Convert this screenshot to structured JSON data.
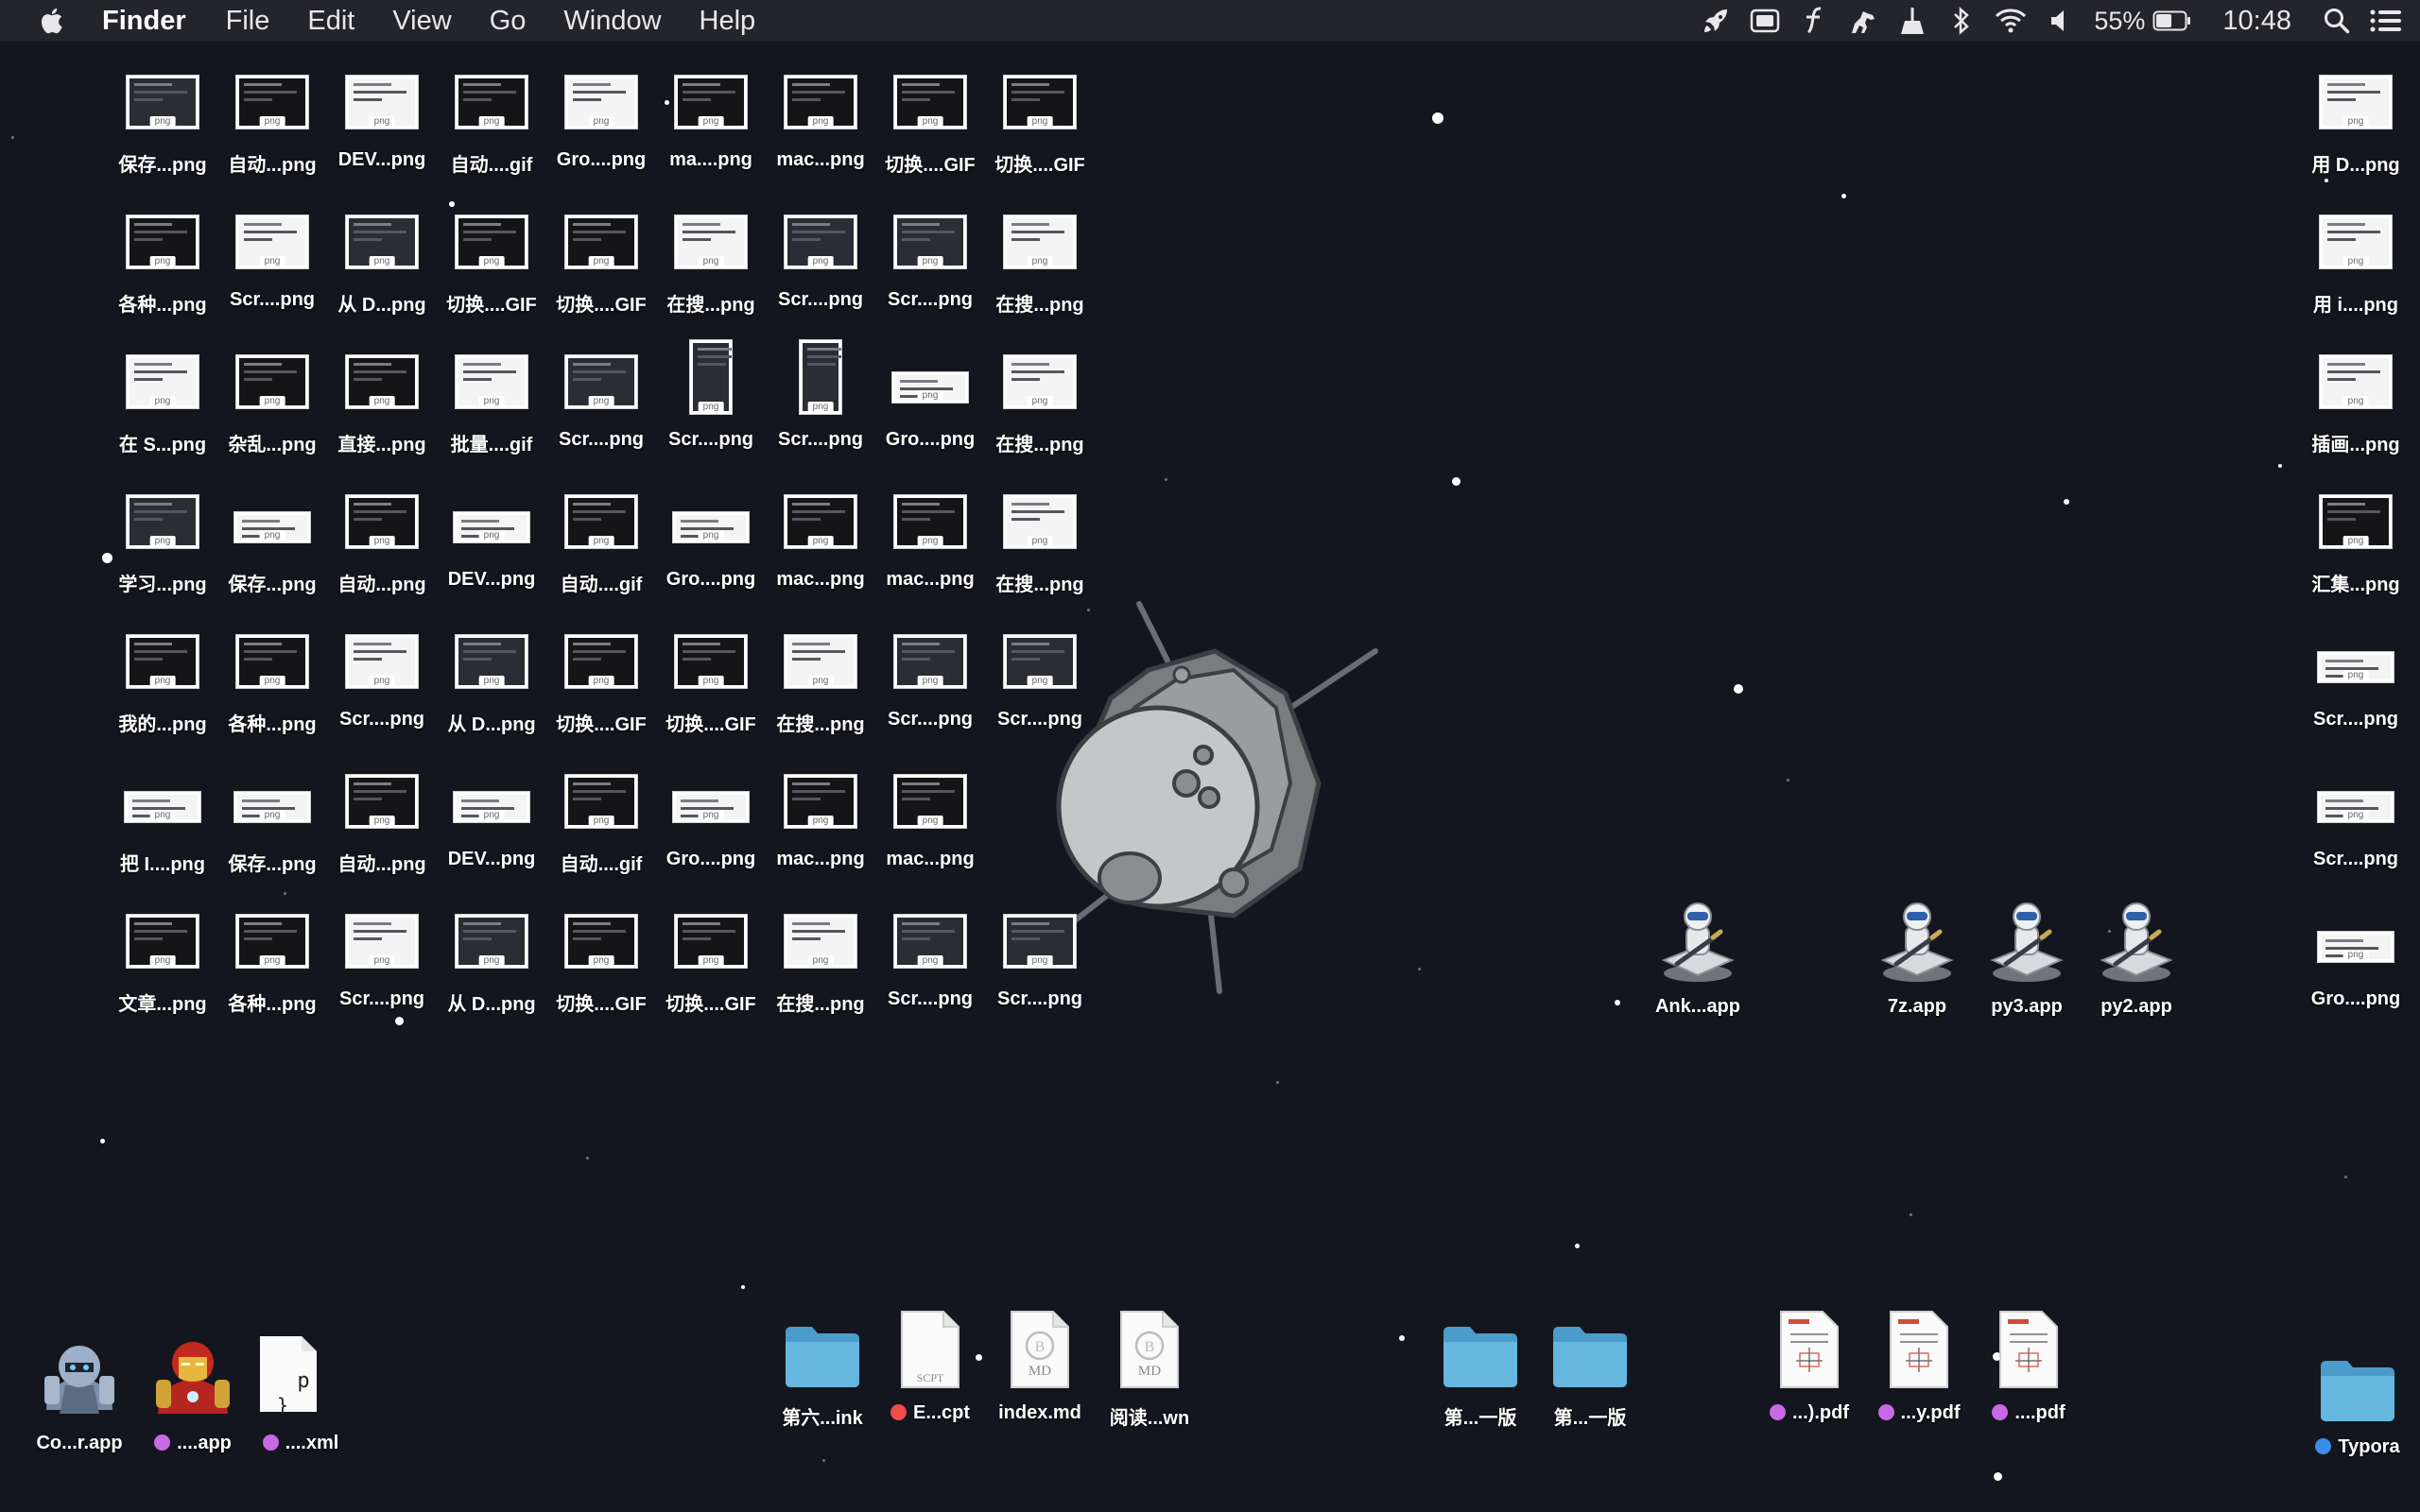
{
  "menubar": {
    "app_name": "Finder",
    "menus": [
      "File",
      "Edit",
      "View",
      "Go",
      "Window",
      "Help"
    ],
    "status_icons": [
      "rocket-icon",
      "vm-icon",
      "typography-icon",
      "horse-icon",
      "broom-icon",
      "bluetooth-icon",
      "wifi-icon",
      "volume-icon"
    ],
    "battery_percent": "55%",
    "battery_level": 0.55,
    "clock": "10:48"
  },
  "grid_rows": [
    [
      {
        "label": "保存...png",
        "thumb": "mid"
      },
      {
        "label": "自动...png",
        "thumb": "dark"
      },
      {
        "label": "DEV...png",
        "thumb": "white"
      },
      {
        "label": "自动....gif",
        "thumb": "dark"
      },
      {
        "label": "Gro....png",
        "thumb": "white"
      },
      {
        "label": "ma....png",
        "thumb": "dark"
      },
      {
        "label": "mac...png",
        "thumb": "dark"
      },
      {
        "label": "切换....GIF",
        "thumb": "dark"
      },
      {
        "label": "切换....GIF",
        "thumb": "dark"
      }
    ],
    [
      {
        "label": "各种...png",
        "thumb": "dark"
      },
      {
        "label": "Scr....png",
        "thumb": "white"
      },
      {
        "label": "从 D...png",
        "thumb": "mid"
      },
      {
        "label": "切换....GIF",
        "thumb": "dark"
      },
      {
        "label": "切换....GIF",
        "thumb": "dark"
      },
      {
        "label": "在搜...png",
        "thumb": "white"
      },
      {
        "label": "Scr....png",
        "thumb": "mid"
      },
      {
        "label": "Scr....png",
        "thumb": "mid"
      },
      {
        "label": "在搜...png",
        "thumb": "white"
      }
    ],
    [
      {
        "label": "在 S...png",
        "thumb": "white"
      },
      {
        "label": "杂乱...png",
        "thumb": "dark"
      },
      {
        "label": "直接...png",
        "thumb": "dark"
      },
      {
        "label": "批量....gif",
        "thumb": "white"
      },
      {
        "label": "Scr....png",
        "thumb": "mid"
      },
      {
        "label": "Scr....png",
        "thumb": "mid",
        "shape": "tall"
      },
      {
        "label": "Scr....png",
        "thumb": "mid",
        "shape": "tall"
      },
      {
        "label": "Gro....png",
        "thumb": "white",
        "shape": "wide"
      },
      {
        "label": "在搜...png",
        "thumb": "white"
      }
    ],
    [
      {
        "label": "学习...png",
        "thumb": "mid"
      },
      {
        "label": "保存...png",
        "thumb": "white",
        "shape": "wide"
      },
      {
        "label": "自动...png",
        "thumb": "dark"
      },
      {
        "label": "DEV...png",
        "thumb": "white",
        "shape": "wide"
      },
      {
        "label": "自动....gif",
        "thumb": "dark"
      },
      {
        "label": "Gro....png",
        "thumb": "white",
        "shape": "wide"
      },
      {
        "label": "mac...png",
        "thumb": "dark"
      },
      {
        "label": "mac...png",
        "thumb": "dark"
      },
      {
        "label": "在搜...png",
        "thumb": "white"
      }
    ],
    [
      {
        "label": "我的...png",
        "thumb": "dark"
      },
      {
        "label": "各种...png",
        "thumb": "dark"
      },
      {
        "label": "Scr....png",
        "thumb": "white"
      },
      {
        "label": "从 D...png",
        "thumb": "mid"
      },
      {
        "label": "切换....GIF",
        "thumb": "dark"
      },
      {
        "label": "切换....GIF",
        "thumb": "dark"
      },
      {
        "label": "在搜...png",
        "thumb": "white"
      },
      {
        "label": "Scr....png",
        "thumb": "mid"
      },
      {
        "label": "Scr....png",
        "thumb": "mid"
      }
    ],
    [
      {
        "label": "把 I....png",
        "thumb": "white",
        "shape": "wide"
      },
      {
        "label": "保存...png",
        "thumb": "white",
        "shape": "wide"
      },
      {
        "label": "自动...png",
        "thumb": "dark"
      },
      {
        "label": "DEV...png",
        "thumb": "white",
        "shape": "wide"
      },
      {
        "label": "自动....gif",
        "thumb": "dark"
      },
      {
        "label": "Gro....png",
        "thumb": "white",
        "shape": "wide"
      },
      {
        "label": "mac...png",
        "thumb": "dark"
      },
      {
        "label": "mac...png",
        "thumb": "dark"
      }
    ],
    [
      {
        "label": "文章...png",
        "thumb": "dark"
      },
      {
        "label": "各种...png",
        "thumb": "dark"
      },
      {
        "label": "Scr....png",
        "thumb": "white"
      },
      {
        "label": "从 D...png",
        "thumb": "mid"
      },
      {
        "label": "切换....GIF",
        "thumb": "dark"
      },
      {
        "label": "切换....GIF",
        "thumb": "dark"
      },
      {
        "label": "在搜...png",
        "thumb": "white"
      },
      {
        "label": "Scr....png",
        "thumb": "mid"
      },
      {
        "label": "Scr....png",
        "thumb": "mid"
      }
    ]
  ],
  "thumb_ext": "png",
  "right_column": [
    {
      "label": "用 D...png",
      "thumb": "white"
    },
    {
      "label": "用 i....png",
      "thumb": "white"
    },
    {
      "label": "插画...png",
      "thumb": "white"
    },
    {
      "label": "汇集...png",
      "thumb": "dark"
    },
    {
      "label": "Scr....png",
      "thumb": "white",
      "shape": "wide"
    },
    {
      "label": "Scr....png",
      "thumb": "white",
      "shape": "wide"
    },
    {
      "label": "Gro....png",
      "thumb": "white",
      "shape": "wide"
    }
  ],
  "automator_apps": [
    {
      "label": "Ank...app"
    },
    {
      "label": "7z.app"
    },
    {
      "label": "py3.app"
    },
    {
      "label": "py2.app"
    }
  ],
  "bottom_left": [
    {
      "label": "Co...r.app",
      "type": "mech-app"
    },
    {
      "label": "....app",
      "type": "ironman-app",
      "tag": "#c968e6"
    },
    {
      "label": "....xml",
      "type": "xml-doc",
      "tag": "#c968e6"
    }
  ],
  "bottom_center": [
    {
      "label": "第六...ink",
      "type": "folder"
    },
    {
      "label": "E...cpt",
      "type": "scpt",
      "tag": "#ef4b4b",
      "doc_text": "SCPT"
    },
    {
      "label": "index.md",
      "type": "md",
      "doc_text": "MD"
    },
    {
      "label": "阅读...wn",
      "type": "md",
      "doc_text": "MD"
    }
  ],
  "bottom_folders": [
    {
      "label": "第...一版"
    },
    {
      "label": "第...一版"
    }
  ],
  "bottom_pdfs": [
    {
      "label": "...).pdf",
      "tag": "#c968e6"
    },
    {
      "label": "...y.pdf",
      "tag": "#c968e6"
    },
    {
      "label": "....pdf",
      "tag": "#c968e6"
    }
  ],
  "typora": {
    "label": "Typora",
    "tag": "#3a8ee6"
  },
  "colors": {
    "background": "#14161f",
    "menubar": "#24252b",
    "folder": "#5ab0dc"
  }
}
